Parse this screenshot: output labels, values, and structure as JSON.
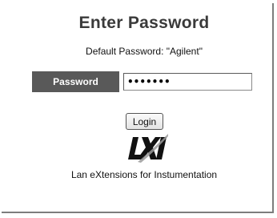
{
  "header": {
    "title": "Enter Password",
    "default_password_note": "Default Password: \"Agilent\""
  },
  "form": {
    "password_label": "Password",
    "password_value": "Agilent",
    "login_label": "Login"
  },
  "logo": {
    "icon": "lxi-logo",
    "text": "LXI"
  },
  "footer": {
    "text": "Lan eXtensions for Instumentation"
  },
  "colors": {
    "label_bg": "#595959",
    "title": "#3a3a3a"
  }
}
